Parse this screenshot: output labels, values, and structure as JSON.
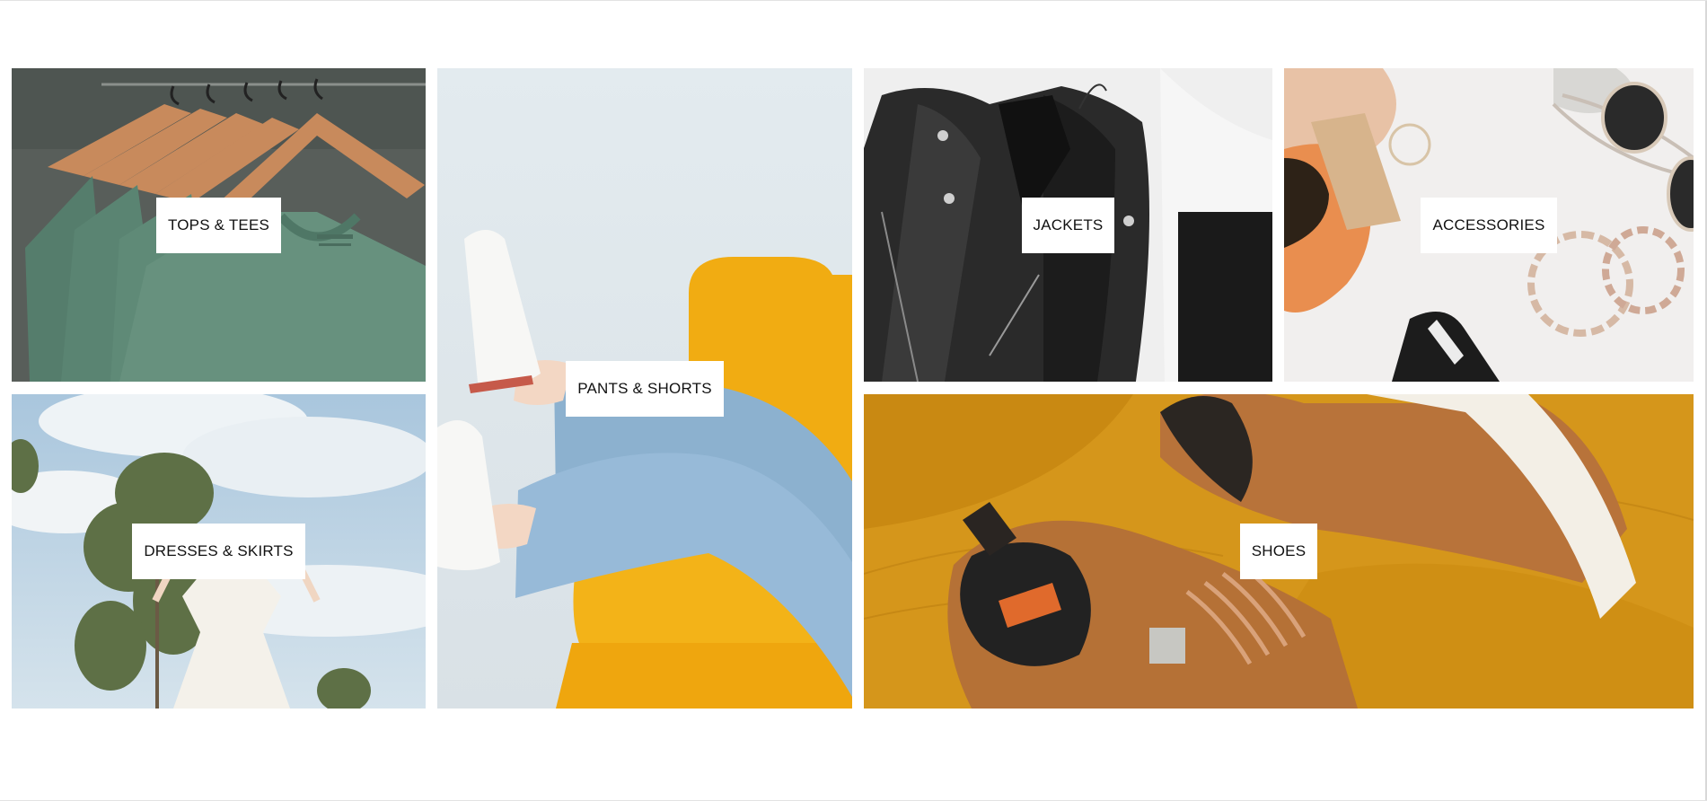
{
  "categories": [
    {
      "id": "tops",
      "label": "TOPS & TEES",
      "color": "#5e8a77"
    },
    {
      "id": "pants",
      "label": "PANTS & SHORTS",
      "color": "#f0a90c"
    },
    {
      "id": "jackets",
      "label": "JACKETS",
      "color": "#1f1f1f"
    },
    {
      "id": "accessories",
      "label": "ACCESSORIES",
      "color": "#e89a60"
    },
    {
      "id": "dresses",
      "label": "DRESSES & SKIRTS",
      "color": "#c9dbe8"
    },
    {
      "id": "shoes",
      "label": "SHOES",
      "color": "#c98a1e"
    }
  ]
}
